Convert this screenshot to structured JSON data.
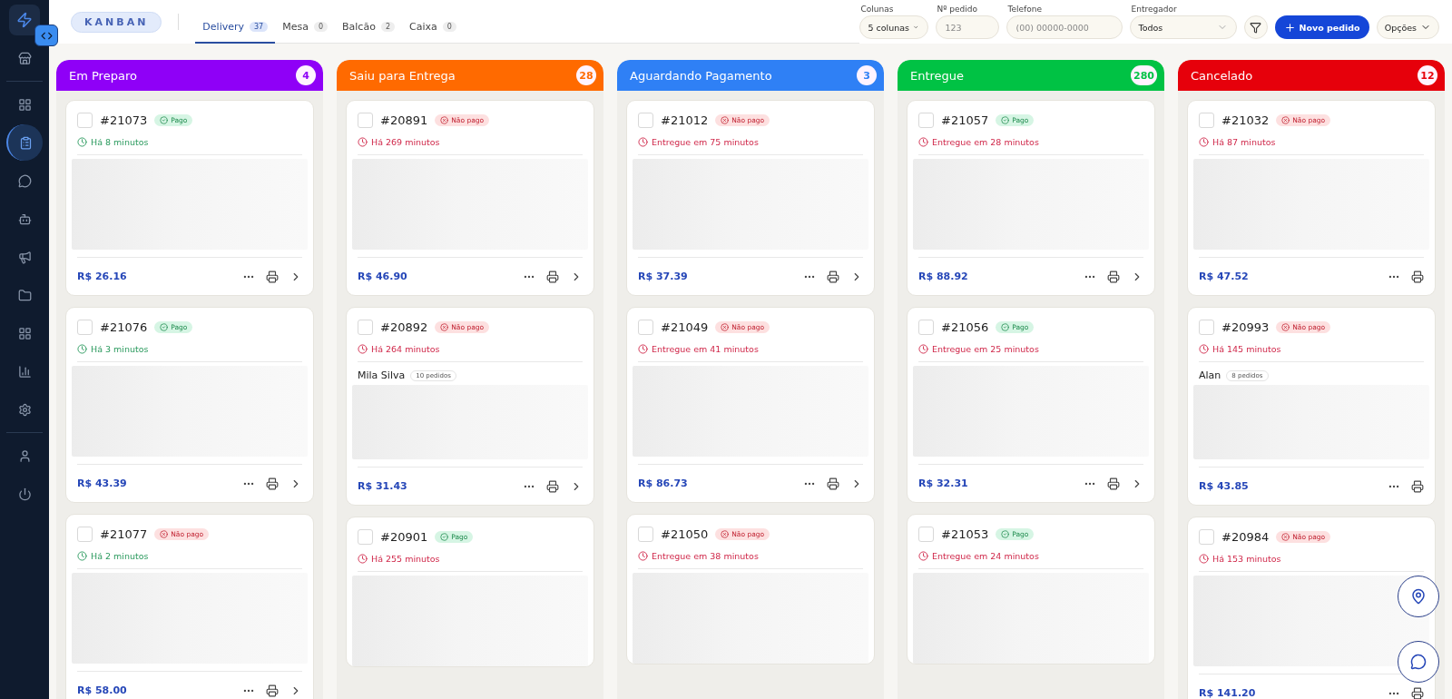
{
  "sidebar": {
    "items": [
      {
        "selected": false
      },
      {
        "selected": false
      },
      {
        "selected": true
      },
      {
        "selected": false
      },
      {
        "selected": false
      },
      {
        "selected": false
      },
      {
        "selected": false
      },
      {
        "selected": false
      },
      {
        "selected": false
      },
      {
        "selected": false
      },
      {
        "selected": false
      },
      {
        "selected": false
      }
    ]
  },
  "header": {
    "view_label": "KANBAN",
    "tabs": [
      {
        "label": "Delivery",
        "count": "37",
        "selected": true
      },
      {
        "label": "Mesa",
        "count": "0",
        "selected": false
      },
      {
        "label": "Balcão",
        "count": "2",
        "selected": false
      },
      {
        "label": "Caixa",
        "count": "0",
        "selected": false
      }
    ],
    "filters": [
      {
        "label": "Colunas",
        "kind": "select",
        "value": "5 colunas"
      },
      {
        "label": "Nº pedido",
        "kind": "input",
        "placeholder": "123"
      },
      {
        "label": "Telefone",
        "kind": "input",
        "placeholder": "(00) 00000-0000"
      },
      {
        "label": "Entregador",
        "kind": "dropdown",
        "value": "Todos"
      }
    ],
    "new_order_button": "Novo pedido",
    "options_button": "Opções"
  },
  "columns": [
    {
      "title": "Em Preparo",
      "count": "4",
      "color": "#8f00f7",
      "cards": [
        {
          "number": "#21073",
          "paid": true,
          "status": "Pago",
          "time": "Há 8 minutos",
          "late": false,
          "checked": false,
          "total": "R$ 26.16",
          "openable": true
        },
        {
          "number": "#21076",
          "paid": true,
          "status": "Pago",
          "time": "Há 3 minutos",
          "late": false,
          "checked": false,
          "total": "R$ 43.39",
          "openable": true
        },
        {
          "number": "#21077",
          "paid": false,
          "status": "Não pago",
          "time": "Há 2 minutos",
          "late": false,
          "checked": false,
          "total": "R$ 58.00",
          "openable": true
        }
      ]
    },
    {
      "title": "Saiu para Entrega",
      "count": "28",
      "color": "#ff6a00",
      "cards": [
        {
          "number": "#20891",
          "paid": false,
          "status": "Não pago",
          "time": "Há 269 minutos",
          "late": true,
          "checked": false,
          "total": "R$ 46.90",
          "openable": true
        },
        {
          "number": "#20892",
          "paid": false,
          "status": "Não pago",
          "time": "Há 264 minutos",
          "late": true,
          "checked": false,
          "customer": "Mila Silva",
          "orders": "10 pedidos",
          "total": "R$ 31.43",
          "openable": true
        },
        {
          "number": "#20901",
          "paid": true,
          "status": "Pago",
          "time": "Há 255 minutos",
          "late": true,
          "checked": false
        }
      ]
    },
    {
      "title": "Aguardando Pagamento",
      "count": "3",
      "color": "#2f80f5",
      "cards": [
        {
          "number": "#21012",
          "paid": false,
          "status": "Não pago",
          "time": "Entregue em 75 minutos",
          "late": true,
          "checked": false,
          "total": "R$ 37.39",
          "openable": true
        },
        {
          "number": "#21049",
          "paid": false,
          "status": "Não pago",
          "time": "Entregue em 41 minutos",
          "late": true,
          "checked": false,
          "total": "R$ 86.73",
          "openable": true
        },
        {
          "number": "#21050",
          "paid": false,
          "status": "Não pago",
          "time": "Entregue em 38 minutos",
          "late": true,
          "checked": false
        }
      ]
    },
    {
      "title": "Entregue",
      "count": "280",
      "color": "#00c244",
      "cards": [
        {
          "number": "#21057",
          "paid": true,
          "status": "Pago",
          "time": "Entregue em 28 minutos",
          "late": true,
          "checked": false,
          "total": "R$ 88.92",
          "openable": true
        },
        {
          "number": "#21056",
          "paid": true,
          "status": "Pago",
          "time": "Entregue em 25 minutos",
          "late": true,
          "checked": false,
          "total": "R$ 32.31",
          "openable": true
        },
        {
          "number": "#21053",
          "paid": true,
          "status": "Pago",
          "time": "Entregue em 24 minutos",
          "late": true,
          "checked": false
        }
      ]
    },
    {
      "title": "Cancelado",
      "count": "12",
      "color": "#e6000b",
      "cards": [
        {
          "number": "#21032",
          "paid": false,
          "status": "Não pago",
          "time": "Há 87 minutos",
          "late": true,
          "checked": false,
          "total": "R$ 47.52",
          "openable": false
        },
        {
          "number": "#20993",
          "paid": false,
          "status": "Não pago",
          "time": "Há 145 minutos",
          "late": true,
          "checked": false,
          "customer": "Alan",
          "orders": "8 pedidos",
          "total": "R$ 43.85",
          "openable": false
        },
        {
          "number": "#20984",
          "paid": false,
          "status": "Não pago",
          "time": "Há 153 minutos",
          "late": true,
          "checked": false,
          "total": "R$ 141.20",
          "openable": false
        }
      ]
    }
  ]
}
